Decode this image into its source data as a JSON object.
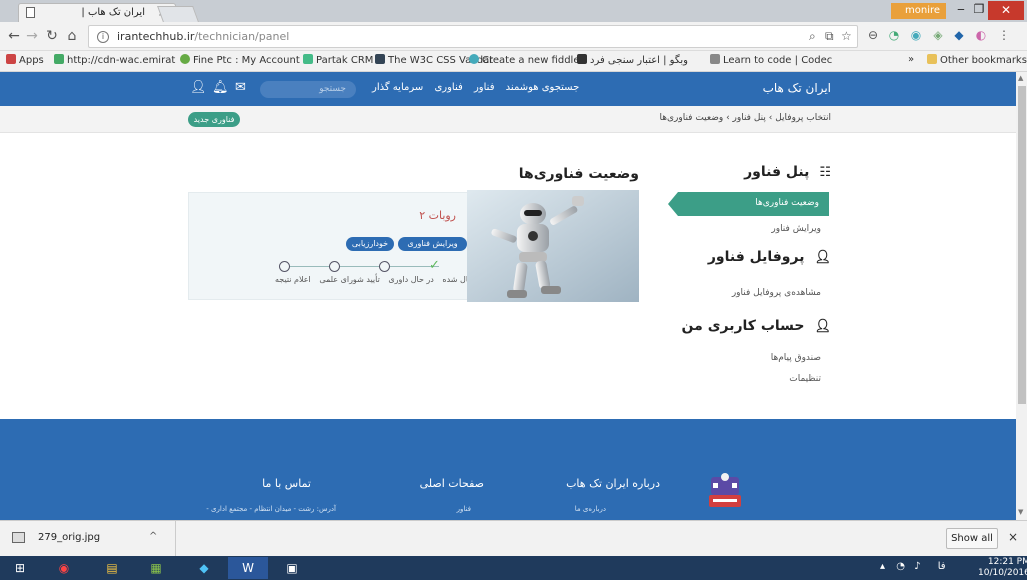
{
  "browser": {
    "tab_title": "ایران تک هاب |",
    "tab_close": "×",
    "user_badge": "monire",
    "url_host": "irantechhub.ir",
    "url_path": "/technician/panel",
    "bookmarks": [
      {
        "label": "Apps",
        "color": "#c44"
      },
      {
        "label": "http://cdn-wac.emirat",
        "color": "#4a6"
      },
      {
        "label": "Fine Ptc : My Account",
        "color": "#6a4"
      },
      {
        "label": "Partak CRM",
        "color": "#4b8"
      },
      {
        "label": "The W3C CSS Validat",
        "color": "#345"
      },
      {
        "label": "Create a new fiddle -",
        "color": "#4ab"
      },
      {
        "label": "وبگو | اعتبار سنجی فرد",
        "color": "#333"
      },
      {
        "label": "Learn to code | Codec",
        "color": "#888"
      }
    ],
    "other_bookmarks": "Other bookmarks",
    "overflow": "»"
  },
  "site": {
    "brand": "ایران تک هاب",
    "menu": [
      "جستجوی هوشمند",
      "فناور",
      "فناوری",
      "سرمایه گذار"
    ],
    "search_placeholder": "جستجو",
    "breadcrumb": "انتخاب پروفایل  ›  پنل فناور  ›  وضعیت فناوری‌ها",
    "new_tech_button": "فناوری جدید"
  },
  "sidebar": {
    "panel_title": "پنل فناور",
    "panel_items": [
      "وضعیت فناوری‌ها",
      "ویرایش فناور"
    ],
    "profile_title": "پروفایل فناور",
    "profile_items": [
      "مشاهده‌ی پروفایل فناور"
    ],
    "account_title": "حساب کاربری من",
    "account_items": [
      "صندوق پیام‌ها",
      "تنظیمات"
    ]
  },
  "main": {
    "title": "وضعیت فناوری‌ها",
    "card": {
      "title": "روبات ۲",
      "edit_button": "ویرایش فناوری",
      "self_eval_button": "خودارزیابی",
      "steps": [
        "ارسال شده",
        "در حال داوری",
        "تأیید شورای علمی",
        "اعلام نتیجه"
      ]
    }
  },
  "footer": {
    "about_title": "درباره ایران تک هاب",
    "about_text": "درباره‌ی ما",
    "pages_title": "صفحات اصلی",
    "pages_text": "فناور",
    "contact_title": "تماس با ما",
    "contact_text": "آدرس: رشت - میدان انتظام - مجتمع اداری -"
  },
  "downloads": {
    "file_name": "279_orig.jpg",
    "show_all": "Show all",
    "close": "×"
  },
  "taskbar": {
    "time": "12:21 PM",
    "date": "10/10/2016",
    "lang": "فا"
  }
}
